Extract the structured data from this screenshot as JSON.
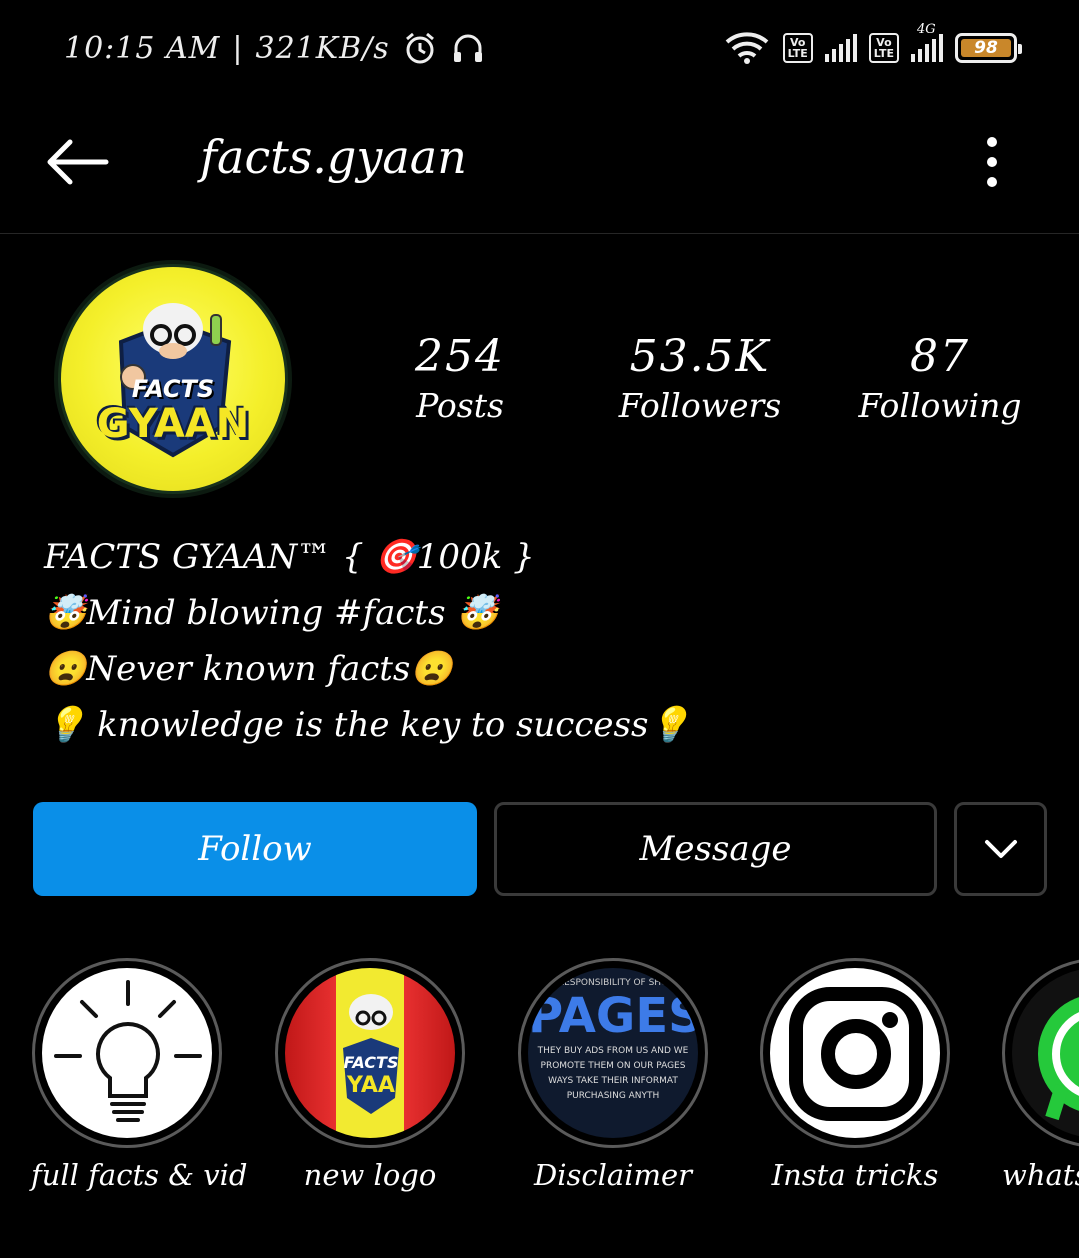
{
  "status_bar": {
    "time": "10:15 AM",
    "network_speed": "321KB/s",
    "lte_label_top": "Vo",
    "lte_label_bottom": "LTE",
    "network_type": "4G",
    "battery": "98"
  },
  "header": {
    "username": "facts.gyaan"
  },
  "profile": {
    "avatar_text_top": "FACTS",
    "avatar_text_bottom": "GYAAN",
    "stats": [
      {
        "value": "254",
        "label": "Posts"
      },
      {
        "value": "53.5K",
        "label": "Followers"
      },
      {
        "value": "87",
        "label": "Following"
      }
    ],
    "bio": [
      "FACTS GYAAN™ { 🎯100k }",
      "🤯Mind blowing #facts 🤯",
      "😦Never known facts😦",
      "💡 knowledge is the key to success💡"
    ]
  },
  "actions": {
    "follow_label": "Follow",
    "message_label": "Message"
  },
  "highlights": [
    {
      "label": "full facts & vid",
      "icon": "lightbulb-icon"
    },
    {
      "label": "new logo",
      "icon": "logo-thumbnail"
    },
    {
      "label": "Disclaimer",
      "icon": "pages-thumbnail",
      "thumb_title": "PAGES.",
      "thumb_top": "RESPONSIBILITY OF SHO",
      "thumb_lines": [
        "THEY BUY ADS FROM US AND WE",
        "PROMOTE THEM ON OUR PAGES",
        "WAYS TAKE THEIR INFORMAT",
        "PURCHASING ANYTH"
      ]
    },
    {
      "label": "Insta tricks",
      "icon": "instagram-icon"
    },
    {
      "label": "whatsA",
      "icon": "whatsapp-icon"
    }
  ],
  "colors": {
    "background": "#000000",
    "follow_button": "#0a8fe8",
    "battery": "#c9872a"
  }
}
